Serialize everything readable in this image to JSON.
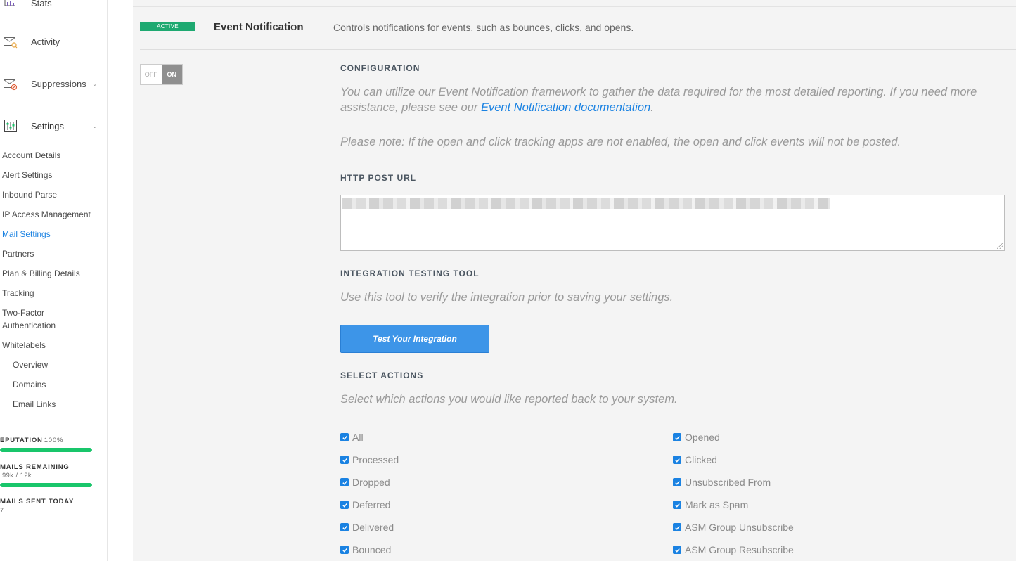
{
  "sidebar": {
    "stats_label": "Stats",
    "activity_label": "Activity",
    "suppressions_label": "Suppressions",
    "settings_label": "Settings",
    "settings_items": [
      "Account Details",
      "Alert Settings",
      "Inbound Parse",
      "IP Access Management",
      "Mail Settings",
      "Partners",
      "Plan & Billing Details",
      "Tracking",
      "Two-Factor",
      "Authentication",
      "Whitelabels"
    ],
    "whitelabel_items": [
      "Overview",
      "Domains",
      "Email Links"
    ],
    "reputation": {
      "title": "EPUTATION",
      "value": "100%",
      "fill": 1.0
    },
    "emails_remaining": {
      "title": "MAILS REMAINING",
      "value": ".99k / 12k",
      "fill": 1.0
    },
    "emails_sent": {
      "title": "MAILS SENT TODAY",
      "value": "7"
    }
  },
  "header": {
    "badge": "ACTIVE",
    "title": "Event Notification",
    "description": "Controls notifications for events, such as bounces, clicks, and opens."
  },
  "toggle": {
    "off_label": "OFF",
    "on_label": "ON",
    "state": "on"
  },
  "configuration": {
    "title": "CONFIGURATION",
    "text_before_link": "You can utilize our Event Notification framework to gather the data required for the most detailed reporting. If you need more assistance, please see our ",
    "link_text": "Event Notification documentation",
    "text_after_link": ".",
    "note": "Please note: If the open and click tracking apps are not enabled, the open and click events will not be posted."
  },
  "http_post": {
    "title": "HTTP POST URL"
  },
  "integration": {
    "title": "INTEGRATION TESTING TOOL",
    "description": "Use this tool to verify the integration prior to saving your settings.",
    "button_label": "Test Your Integration"
  },
  "actions": {
    "title": "SELECT ACTIONS",
    "description": "Select which actions you would like reported back to your system.",
    "left": [
      "All",
      "Processed",
      "Dropped",
      "Deferred",
      "Delivered",
      "Bounced"
    ],
    "right": [
      "Opened",
      "Clicked",
      "Unsubscribed From",
      "Mark as Spam",
      "ASM Group Unsubscribe",
      "ASM Group Resubscribe"
    ]
  },
  "colors": {
    "accent": "#1a82e2",
    "active_badge": "#1ea971",
    "meter": "#19c66b"
  }
}
